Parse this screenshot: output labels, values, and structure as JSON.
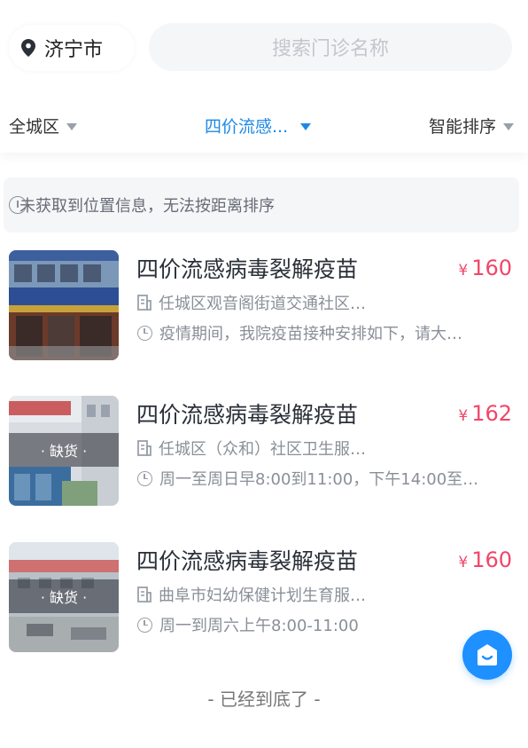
{
  "header": {
    "city": "济宁市",
    "city_icon": "location-pin-icon",
    "search_placeholder": "搜索门诊名称"
  },
  "filters": [
    {
      "label": "全城区",
      "active": false
    },
    {
      "label": "四价流感...",
      "active": true
    },
    {
      "label": "智能排序",
      "active": false
    }
  ],
  "notice": {
    "icon": "info-icon",
    "text": "未获取到位置信息，无法按距离排序"
  },
  "items": [
    {
      "title": "四价流感病毒裂解疫苗",
      "price_symbol": "¥",
      "price": "160",
      "clinic": "任城区观音阁街道交通社区…",
      "hours": "疫情期间，我院疫苗接种安排如下，请大…",
      "out_of_stock": false,
      "badge": ""
    },
    {
      "title": "四价流感病毒裂解疫苗",
      "price_symbol": "¥",
      "price": "162",
      "clinic": "任城区（众和）社区卫生服…",
      "hours": "周一至周日早8:00到11:00，下午14:00至…",
      "out_of_stock": true,
      "badge": "· 缺货 ·"
    },
    {
      "title": "四价流感病毒裂解疫苗",
      "price_symbol": "¥",
      "price": "160",
      "clinic": "曲阜市妇幼保健计划生育服…",
      "hours": "周一到周六上午8:00-11:00",
      "out_of_stock": true,
      "badge": "· 缺货 ·"
    }
  ],
  "footer": {
    "end_text": "- 已经到底了 -"
  },
  "colors": {
    "accent": "#1e88e5",
    "price": "#f0466a",
    "service_button": "#1e90ff"
  }
}
